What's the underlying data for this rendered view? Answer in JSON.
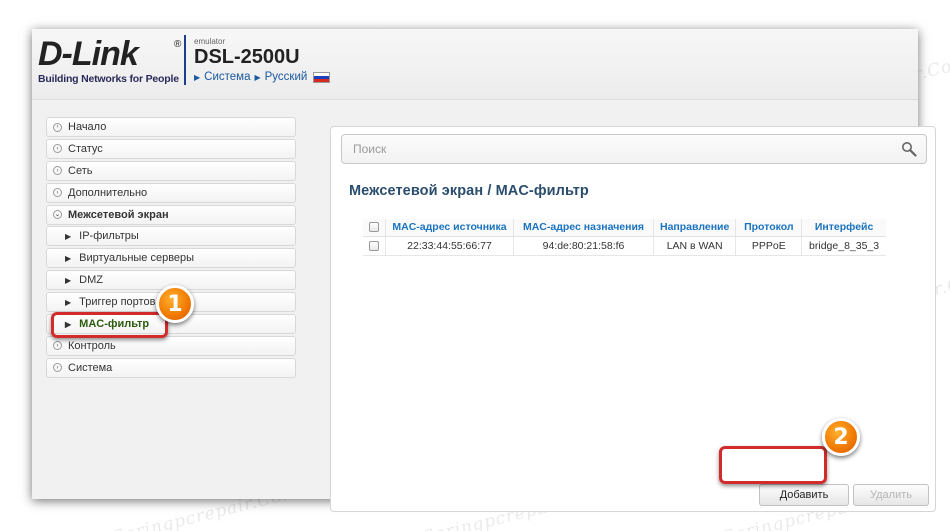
{
  "header": {
    "logo_title": "D-Link",
    "logo_reg": "®",
    "logo_subtitle": "Building Networks for People",
    "emulator_label": "emulator",
    "model": "DSL-2500U",
    "link_system": "Система",
    "link_language": "Русский",
    "flag_colors": [
      "#ffffff",
      "#1f3fbf",
      "#d52b1e"
    ]
  },
  "sidebar": {
    "items": [
      {
        "label": "Начало",
        "type": "top"
      },
      {
        "label": "Статус",
        "type": "top"
      },
      {
        "label": "Сеть",
        "type": "top"
      },
      {
        "label": "Дополнительно",
        "type": "top"
      },
      {
        "label": "Межсетевой экран",
        "type": "top-open"
      },
      {
        "label": "IP-фильтры",
        "type": "sub"
      },
      {
        "label": "Виртуальные серверы",
        "type": "sub"
      },
      {
        "label": "DMZ",
        "type": "sub"
      },
      {
        "label": "Триггер портов",
        "type": "sub"
      },
      {
        "label": "MAC-фильтр",
        "type": "sub-active"
      },
      {
        "label": "Контроль",
        "type": "top"
      },
      {
        "label": "Система",
        "type": "top"
      }
    ]
  },
  "main": {
    "search_placeholder": "Поиск",
    "breadcrumb_parent": "Межсетевой экран",
    "breadcrumb_sep": " / ",
    "breadcrumb_current": "MAC-фильтр",
    "table": {
      "columns": [
        "MAC-адрес источника",
        "MAC-адрес назначения",
        "Направление",
        "Протокол",
        "Интерфейс"
      ],
      "rows": [
        [
          "22:33:44:55:66:77",
          "94:de:80:21:58:f6",
          "LAN в WAN",
          "PPPoE",
          "bridge_8_35_3"
        ]
      ]
    },
    "add_button": "Добавить",
    "delete_button": "Удалить"
  },
  "annotations": {
    "badge_1": "1",
    "badge_2": "2",
    "accent_color": "#d22b2b",
    "badge_color": "#f07800"
  },
  "watermark": "Soringpcrepair.Com"
}
